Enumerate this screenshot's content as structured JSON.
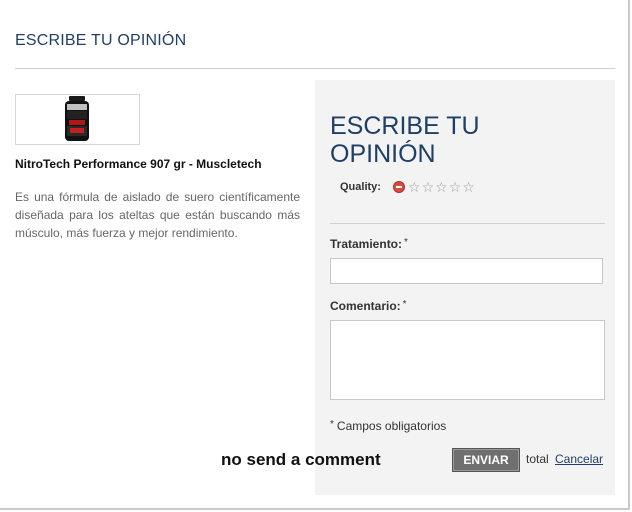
{
  "modal": {
    "title": "ESCRIBE TU OPINIÓN"
  },
  "product": {
    "image_alt": "NitroTech tub",
    "name": "NitroTech Performance 907 gr - Muscletech",
    "description": "Es una fórmula de aislado de suero científicamente diseñada para los ateltas que están buscando más músculo, más fuerza y mejor rendimiento."
  },
  "form": {
    "heading": "ESCRIBE TU OPINIÓN",
    "quality_label": "Quality:",
    "rating": {
      "value": 0,
      "max": 5
    },
    "title_label": "Tratamiento:",
    "title_required_mark": "*",
    "title_value": "",
    "comment_label": "Comentario:",
    "comment_required_mark": "*",
    "comment_value": "",
    "required_mark": "*",
    "required_note": "Campos obligatorios",
    "status_message": "no send a comment",
    "send_label": "ENVIAR",
    "total_label": "total",
    "cancel_label": "Cancelar"
  },
  "colors": {
    "accent": "#1f3f66",
    "panel_bg": "#f3f3f3",
    "button_bg": "#6f6f6f",
    "cancel_rating": "#d94a3f"
  }
}
